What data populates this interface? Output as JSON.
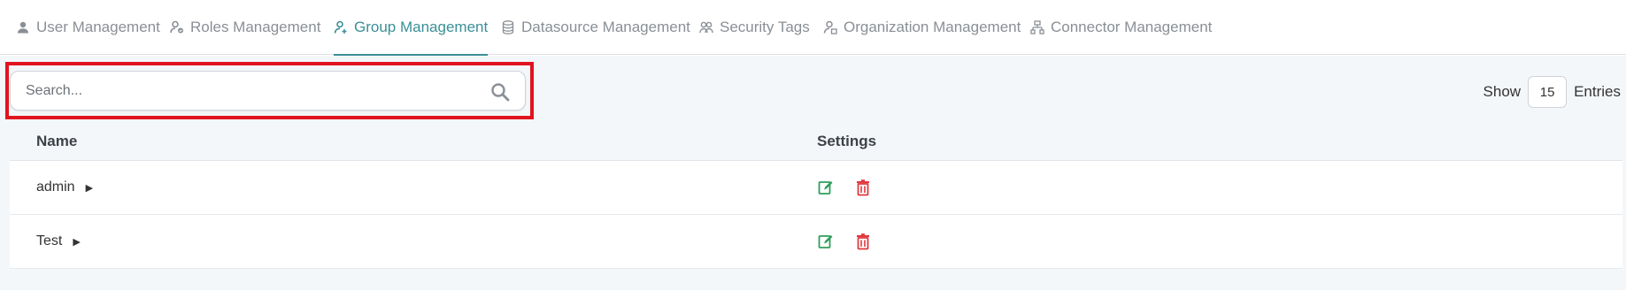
{
  "tabs": [
    {
      "label": "User Management",
      "icon": "user-icon",
      "active": false
    },
    {
      "label": "Roles Management",
      "icon": "roles-icon",
      "active": false
    },
    {
      "label": "Group Management",
      "icon": "group-icon",
      "active": true
    },
    {
      "label": "Datasource Management",
      "icon": "database-icon",
      "active": false
    },
    {
      "label": "Security Tags",
      "icon": "security-tags-icon",
      "active": false
    },
    {
      "label": "Organization Management",
      "icon": "organization-icon",
      "active": false
    },
    {
      "label": "Connector Management",
      "icon": "connector-icon",
      "active": false
    }
  ],
  "search": {
    "placeholder": "Search...",
    "value": ""
  },
  "pagination": {
    "show_label": "Show",
    "entries_value": "15",
    "entries_label": "Entries"
  },
  "table": {
    "headers": {
      "name": "Name",
      "settings": "Settings"
    },
    "rows": [
      {
        "name": "admin"
      },
      {
        "name": "Test"
      }
    ]
  },
  "colors": {
    "accent": "#3a8f97",
    "edit": "#2e9e5b",
    "delete": "#e0393e",
    "highlight": "#e0141f"
  }
}
